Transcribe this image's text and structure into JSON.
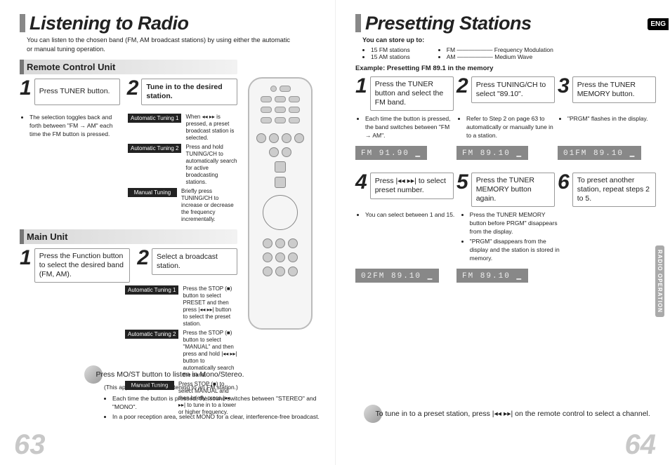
{
  "badges": {
    "lang": "ENG",
    "side": "RADIO OPERATION"
  },
  "pages": {
    "left": "63",
    "right": "64"
  },
  "left": {
    "title": "Listening to Radio",
    "intro": "You can listen to the chosen band (FM, AM broadcast stations) by using either the automatic or manual tuning operation.",
    "remote_section": "Remote Control Unit",
    "main_section": "Main Unit",
    "step1": "Press TUNER button.",
    "step1_note": "The selection toggles back and forth between \"FM → AM\" each time the FM button is pressed.",
    "step2": "Tune in to the desired station.",
    "auto1_label": "Automatic Tuning 1",
    "auto1_text": "When ◂◂ ▸▸ is pressed, a preset broadcast station is selected.",
    "auto2_label": "Automatic Tuning 2",
    "auto2_text": "Press and hold TUNING/CH to automatically search for active broadcasting stations.",
    "manual_label": "Manual Tuning",
    "manual_text": "Briefly press TUNING/CH to increase or decrease the frequency incrementally.",
    "main_step1": "Press the Function button to select the desired band (FM, AM).",
    "main_step2": "Select a broadcast station.",
    "m_auto1_label": "Automatic Tuning 1",
    "m_auto1_text": "Press the STOP (■) button to select PRESET and then press |◂◂ ▸▸| button to select the preset station.",
    "m_auto2_label": "Automatic Tuning 2",
    "m_auto2_text": "Press the STOP (■) button to select \"MANUAL\" and then press and hold |◂◂ ▸▸| button to automatically search the band.",
    "m_manual_label": "Manual Tuning",
    "m_manual_text": "Press STOP (■) to select MANUAL and then briefly press |◂◂ ▸▸| to tune in to a lower or higher frequency.",
    "tip_head": "Press MO/ST button to listen in Mono/Stereo.",
    "tip_sub": "(This applies only when listening to an FM station.)",
    "tip_b1": "Each time the button is pressed, the sound switches between \"STEREO\" and \"MONO\".",
    "tip_b2": "In a poor reception area, select MONO for a clear, interference-free broadcast."
  },
  "right": {
    "title": "Presetting Stations",
    "you_can_store": "You can store up to:",
    "store_a": "15 FM stations",
    "store_b": "15 AM stations",
    "fm_abbr": "FM —————— Frequency Modulation",
    "am_abbr": "AM —————— Medium Wave",
    "example": "Example: Presetting FM 89.1 in the memory",
    "step1": "Press the TUNER button and select the FM band.",
    "step1_note": "Each time the button is pressed, the band switches between \"FM → AM\".",
    "step2": "Press TUNING/CH to select \"89.10\".",
    "step2_note": "Refer to Step 2 on page 63 to automatically or manually tune in to a station.",
    "step3": "Press the TUNER MEMORY button.",
    "step3_note": "\"PRGM\" flashes in the display.",
    "lcd1": "FM  91.90 ▁",
    "lcd2": "FM  89.10 ▁",
    "lcd3": "01FM 89.10 ▁",
    "step4": "Press |◂◂ ▸▸| to select preset number.",
    "step4_note": "You can select between 1 and 15.",
    "step5": "Press the TUNER MEMORY button again.",
    "step5_note_a": "Press the TUNER MEMORY button before PRGM\" disappears from the display.",
    "step5_note_b": "\"PRGM\" disappears from the display and the station is stored in memory.",
    "step6": "To preset another station, repeat steps 2 to 5.",
    "lcd4": "02FM 89.10 ▁",
    "lcd5": "FM  89.10 ▁",
    "tip": "To tune in to a preset station, press |◂◂ ▸▸| on the remote control to select a channel."
  }
}
